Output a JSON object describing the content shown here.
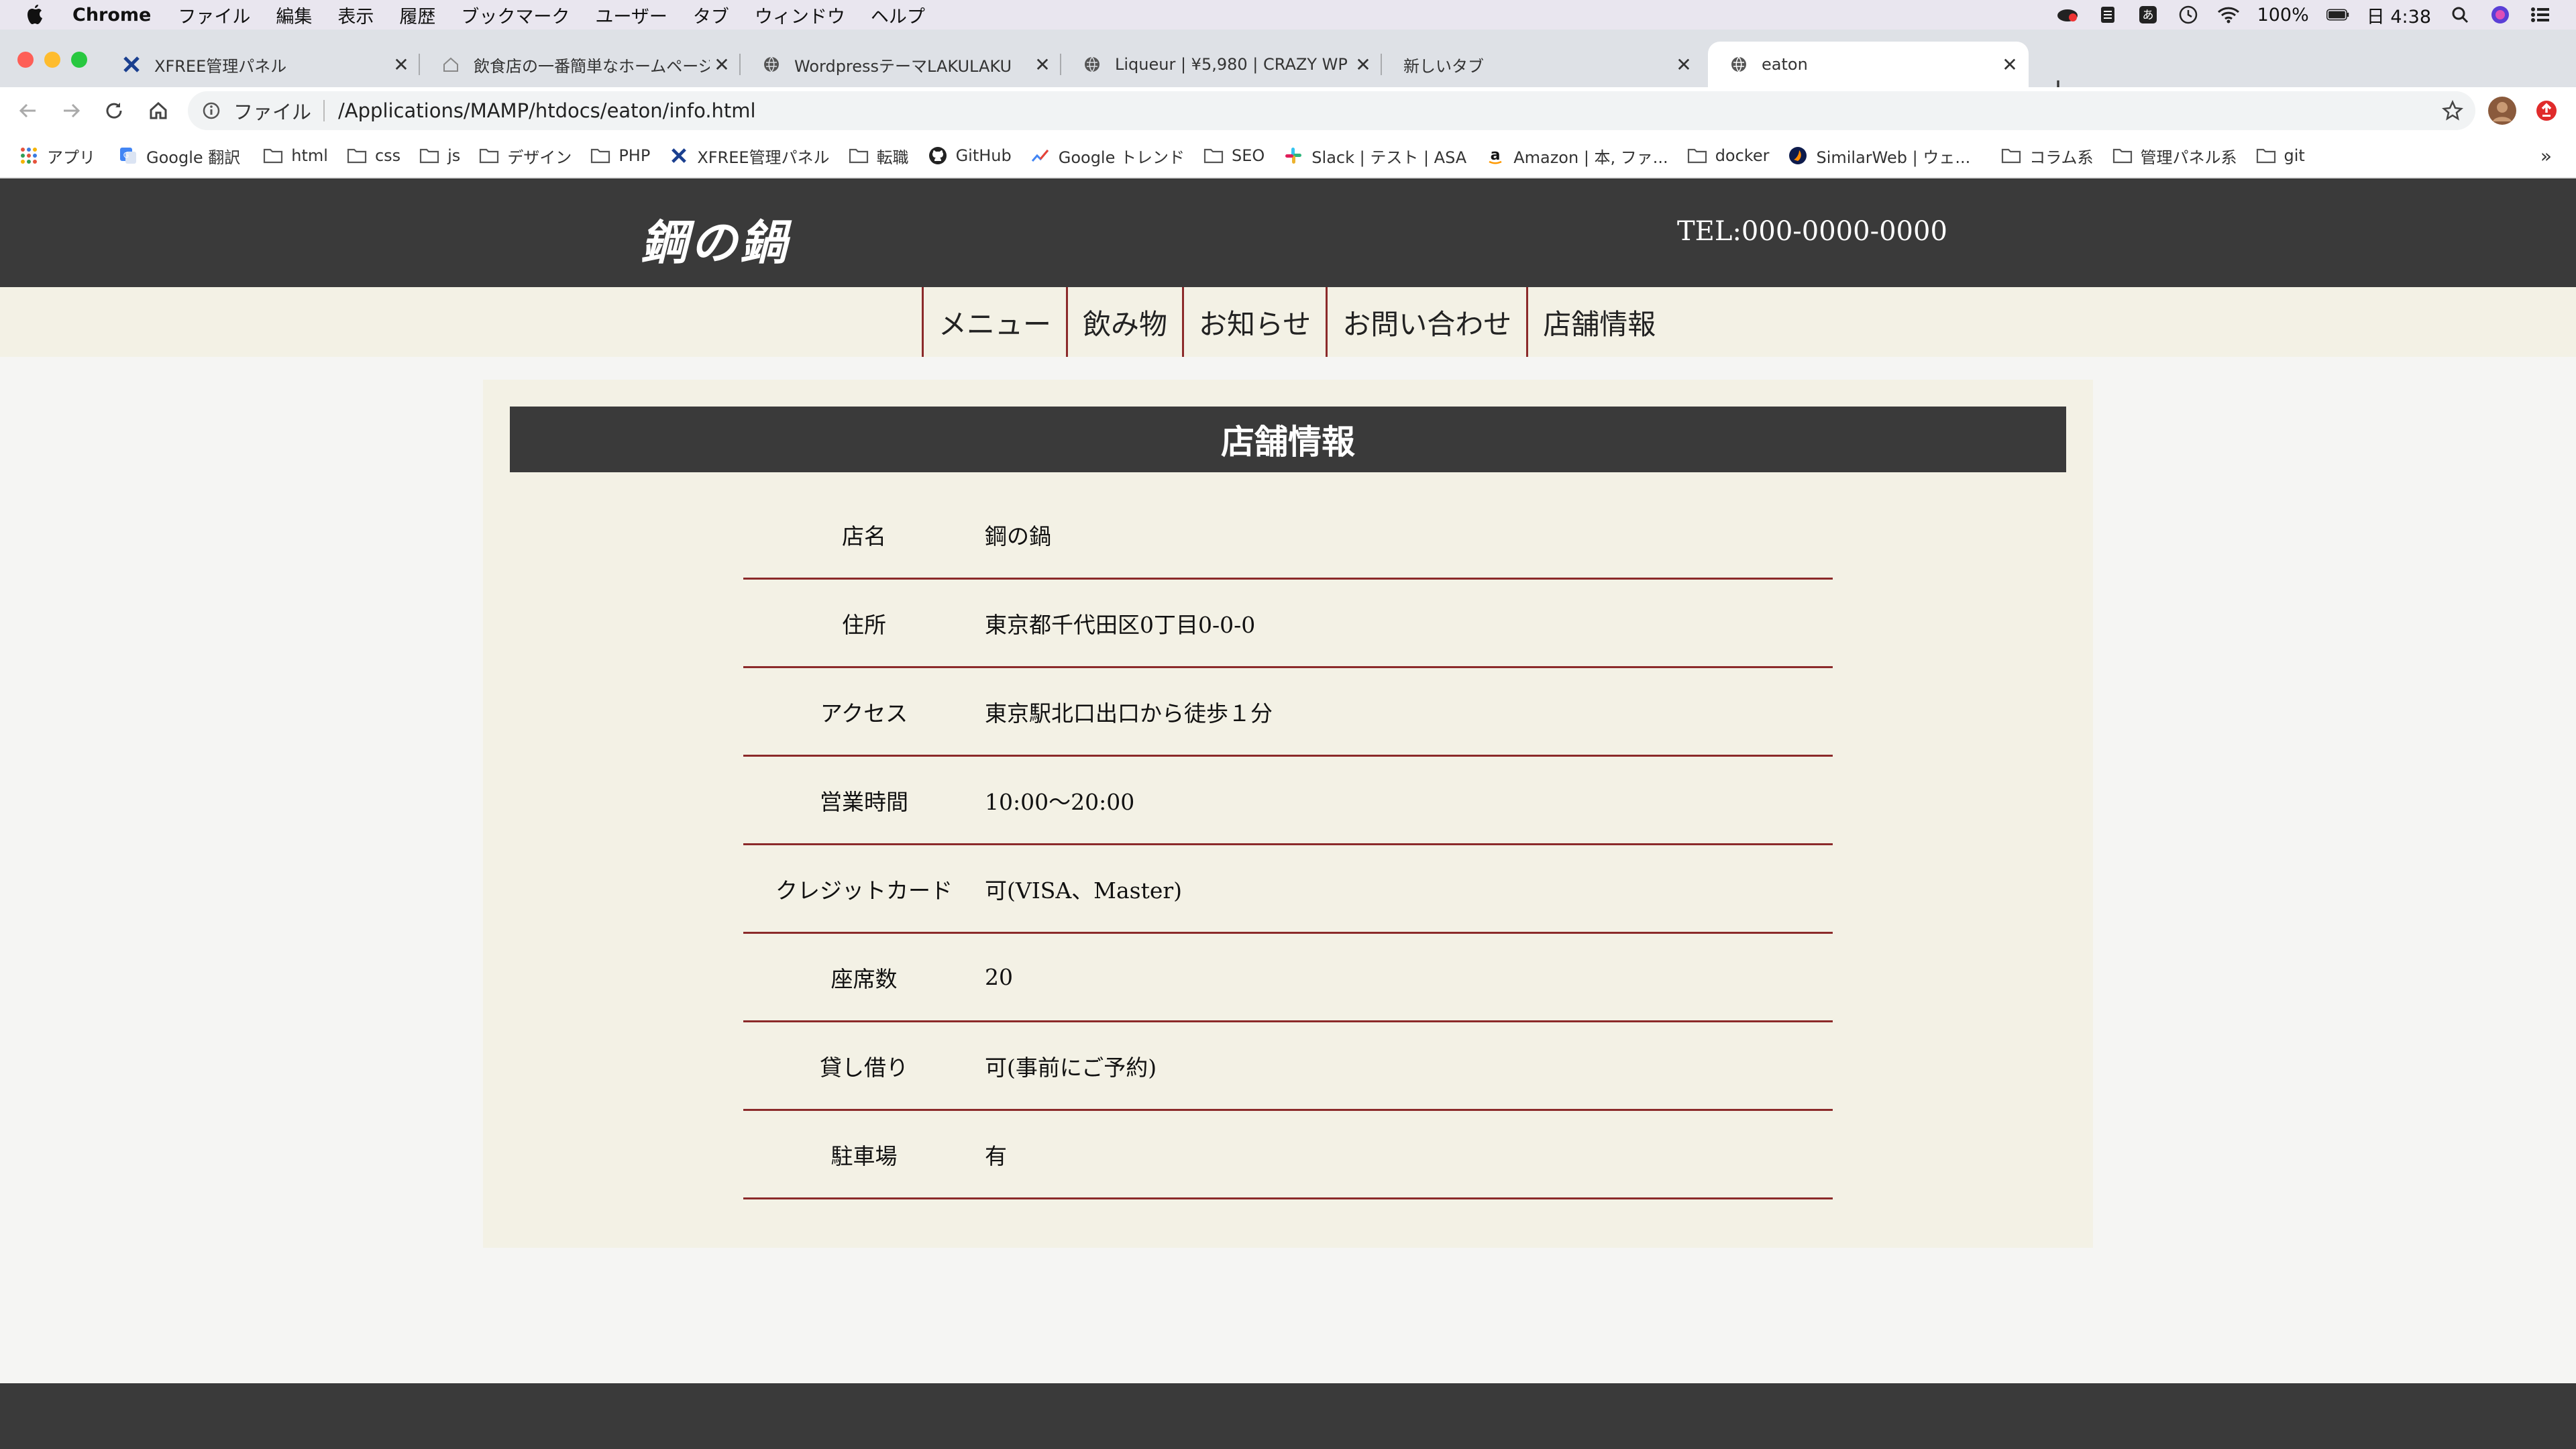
{
  "menubar": {
    "app_name": "Chrome",
    "items": [
      "ファイル",
      "編集",
      "表示",
      "履歴",
      "ブックマーク",
      "ユーザー",
      "タブ",
      "ウィンドウ",
      "ヘルプ"
    ],
    "battery": "100%",
    "clock": "日 4:38"
  },
  "tabs": [
    {
      "label": "XFREE管理パネル",
      "icon": "xfree-icon"
    },
    {
      "label": "飲食店の一番簡単なホームページ作",
      "icon": "house-icon"
    },
    {
      "label": "WordpressテーマLAKULAKU",
      "icon": "globe-icon"
    },
    {
      "label": "Liqueur | ¥5,980 | CRAZY WP",
      "icon": "globe-icon"
    },
    {
      "label": "新しいタブ",
      "icon": ""
    },
    {
      "label": "eaton",
      "icon": "globe-icon",
      "active": true
    }
  ],
  "toolbar": {
    "scheme_label": "ファイル",
    "url": "/Applications/MAMP/htdocs/eaton/info.html"
  },
  "bookmarks": [
    {
      "label": "アプリ",
      "icon": "apps-grid-icon"
    },
    {
      "label": "Google 翻訳",
      "icon": "google-translate-icon"
    },
    {
      "label": "html",
      "icon": "folder-icon"
    },
    {
      "label": "css",
      "icon": "folder-icon"
    },
    {
      "label": "js",
      "icon": "folder-icon"
    },
    {
      "label": "デザイン",
      "icon": "folder-icon"
    },
    {
      "label": "PHP",
      "icon": "folder-icon"
    },
    {
      "label": "XFREE管理パネル",
      "icon": "xfree-icon"
    },
    {
      "label": "転職",
      "icon": "folder-icon"
    },
    {
      "label": "GitHub",
      "icon": "github-icon"
    },
    {
      "label": "Google トレンド",
      "icon": "trends-icon"
    },
    {
      "label": "SEO",
      "icon": "folder-icon"
    },
    {
      "label": "Slack | テスト | ASA",
      "icon": "slack-icon"
    },
    {
      "label": "Amazon | 本, ファ...",
      "icon": "amazon-icon"
    },
    {
      "label": "docker",
      "icon": "folder-icon"
    },
    {
      "label": "SimilarWeb | ウェ...",
      "icon": "similarweb-icon"
    },
    {
      "label": "コラム系",
      "icon": "folder-icon"
    },
    {
      "label": "管理パネル系",
      "icon": "folder-icon"
    },
    {
      "label": "git",
      "icon": "folder-icon"
    }
  ],
  "bookmarks_more": "»",
  "site": {
    "logo": "鋼の鍋",
    "tel": "TEL:000-0000-0000",
    "nav": [
      "メニュー",
      "飲み物",
      "お知らせ",
      "お問い合わせ",
      "店舗情報"
    ],
    "section_title": "店舗情報",
    "info_rows": [
      {
        "label": "店名",
        "value": "鋼の鍋"
      },
      {
        "label": "住所",
        "value": "東京都千代田区0丁目0-0-0"
      },
      {
        "label": "アクセス",
        "value": "東京駅北口出口から徒歩１分"
      },
      {
        "label": "営業時間",
        "value": "10:00〜20:00"
      },
      {
        "label": "クレジットカード",
        "value": "可(VISA、Master)"
      },
      {
        "label": "座席数",
        "value": "20"
      },
      {
        "label": "貸し借り",
        "value": "可(事前にご予約)"
      },
      {
        "label": "駐車場",
        "value": "有"
      }
    ]
  },
  "colors": {
    "header_bg": "#3a3a3a",
    "cream_bg": "#f3f1e5",
    "accent_red": "#8b2a2a"
  }
}
